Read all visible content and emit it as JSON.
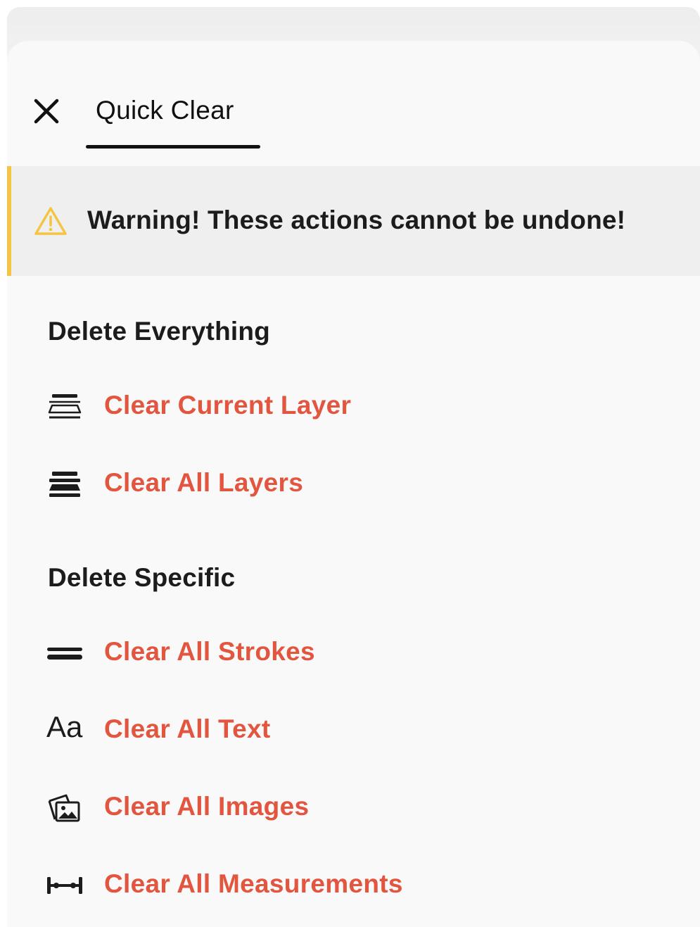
{
  "header": {
    "close_icon": "close-icon",
    "tab_label": "Quick Clear"
  },
  "warning": {
    "icon": "warning-icon",
    "text": "Warning! These actions cannot be undone!",
    "accent_color": "#f4c542"
  },
  "sections": {
    "everything": {
      "title": "Delete Everything",
      "items": [
        {
          "icon": "current-layer-icon",
          "label": "Clear Current Layer"
        },
        {
          "icon": "all-layers-icon",
          "label": "Clear All Layers"
        }
      ]
    },
    "specific": {
      "title": "Delete Specific",
      "items": [
        {
          "icon": "strokes-icon",
          "label": "Clear All Strokes"
        },
        {
          "icon": "text-icon",
          "glyph": "Aa",
          "label": "Clear All Text"
        },
        {
          "icon": "images-icon",
          "label": "Clear All Images"
        },
        {
          "icon": "measurements-icon",
          "label": "Clear All Measurements"
        }
      ]
    }
  },
  "colors": {
    "destructive": "#e2553f",
    "text": "#1c1c1c",
    "sheet_background": "#f9f9f9",
    "warning_background": "#efefef"
  }
}
